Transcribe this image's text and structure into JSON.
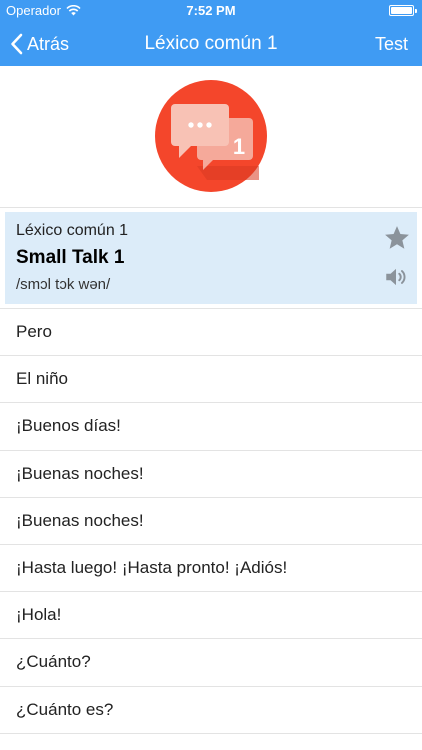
{
  "status_bar": {
    "carrier": "Operador",
    "time": "7:52 PM"
  },
  "nav": {
    "back_label": "Atrás",
    "title": "Léxico común 1",
    "action_label": "Test"
  },
  "badge": {
    "number": "1",
    "circle_color": "#f4462b",
    "bubble_color": "#f5b4a6"
  },
  "card": {
    "category": "Léxico común 1",
    "name": "Small Talk 1",
    "phonetic": "/smɔl tɔk wən/"
  },
  "list": [
    "Pero",
    "El niño",
    "¡Buenos días!",
    "¡Buenas noches!",
    "¡Buenas noches!",
    "¡Hasta luego! ¡Hasta pronto! ¡Adiós!",
    "¡Hola!",
    "¿Cuánto?",
    "¿Cuánto es?"
  ]
}
